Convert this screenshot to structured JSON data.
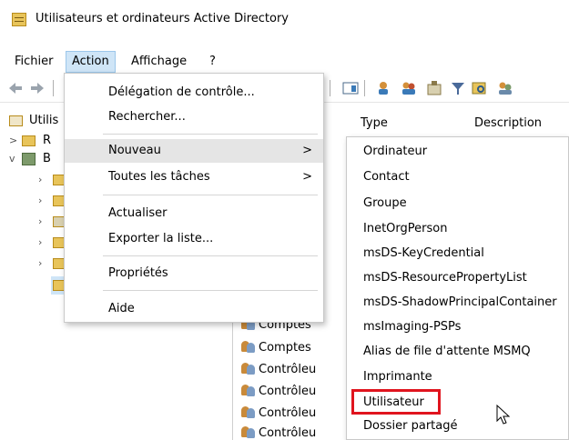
{
  "window": {
    "title": "Utilisateurs et ordinateurs Active Directory",
    "icon": "aduc-icon"
  },
  "menubar": {
    "items": [
      "Fichier",
      "Action",
      "Affichage",
      "?"
    ],
    "open": "Action"
  },
  "tree": {
    "root_label": "Utilis",
    "rows": [
      {
        "chevron": ">",
        "label": "R",
        "icon": "folder-icon"
      },
      {
        "chevron": "v",
        "label": "B",
        "icon": "domain-icon"
      }
    ]
  },
  "list": {
    "columns": [
      "Type",
      "Description"
    ],
    "rows": [
      "Comptes",
      "Comptes",
      "Contrôleu",
      "Contrôleu",
      "Contrôleu",
      "Contrôleu"
    ]
  },
  "action_menu": {
    "items": [
      {
        "label": "Délégation de contrôle...",
        "arrow": ""
      },
      {
        "label": "Rechercher...",
        "arrow": ""
      },
      {
        "label": "Nouveau",
        "arrow": ">"
      },
      {
        "label": "Toutes les tâches",
        "arrow": ">"
      },
      {
        "label": "Actualiser",
        "arrow": ""
      },
      {
        "label": "Exporter la liste...",
        "arrow": ""
      },
      {
        "label": "Propriétés",
        "arrow": ""
      },
      {
        "label": "Aide",
        "arrow": ""
      }
    ],
    "highlighted": "Nouveau"
  },
  "nouveau_menu": {
    "items": [
      "Ordinateur",
      "Contact",
      "Groupe",
      "InetOrgPerson",
      "msDS-KeyCredential",
      "msDS-ResourcePropertyList",
      "msDS-ShadowPrincipalContainer",
      "msImaging-PSPs",
      "Alias de file d'attente MSMQ",
      "Imprimante",
      "Utilisateur",
      "Dossier partagé"
    ],
    "highlighted": "Utilisateur",
    "highlight_color": "#e0141e"
  }
}
